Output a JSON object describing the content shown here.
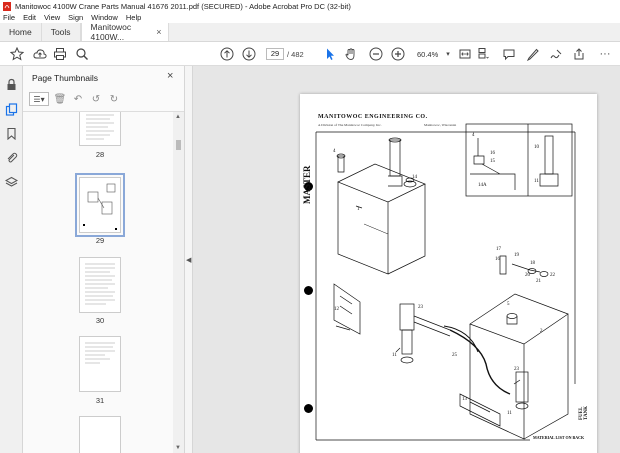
{
  "window": {
    "title": "Manitowoc 4100W Crane Parts Manual 41676 2011.pdf (SECURED) - Adobe Acrobat Pro DC (32-bit)"
  },
  "menu": [
    "File",
    "Edit",
    "View",
    "Sign",
    "Window",
    "Help"
  ],
  "tabs": {
    "home": "Home",
    "tools": "Tools",
    "document": "Manitowoc 4100W..."
  },
  "toolbar": {
    "current_page": "29",
    "page_total": "/ 482",
    "zoom": "60.4%"
  },
  "panel": {
    "title": "Page Thumbnails",
    "thumbnails": [
      {
        "label": "28",
        "selected": false
      },
      {
        "label": "29",
        "selected": true
      },
      {
        "label": "30",
        "selected": false
      },
      {
        "label": "31",
        "selected": false
      }
    ]
  },
  "page": {
    "header": "MANITOWOC ENGINEERING CO.",
    "subheader": "A Division of The Manitowoc Company, Inc.",
    "subheader_right": "Manitowoc, Wisconsin",
    "master_mark": "MASTER",
    "side_title": "FUEL TANK",
    "footer_note": "MATERIAL LIST ON BACK",
    "callouts": [
      "1",
      "2",
      "4",
      "5",
      "10",
      "11",
      "12",
      "13",
      "14",
      "14A",
      "16",
      "17",
      "18",
      "19",
      "20",
      "21",
      "22",
      "23",
      "24",
      "25"
    ]
  },
  "colors": {
    "accent": "#1a73e8",
    "pdf_red": "#d9291c",
    "doc_background": "#e6e6e6"
  }
}
